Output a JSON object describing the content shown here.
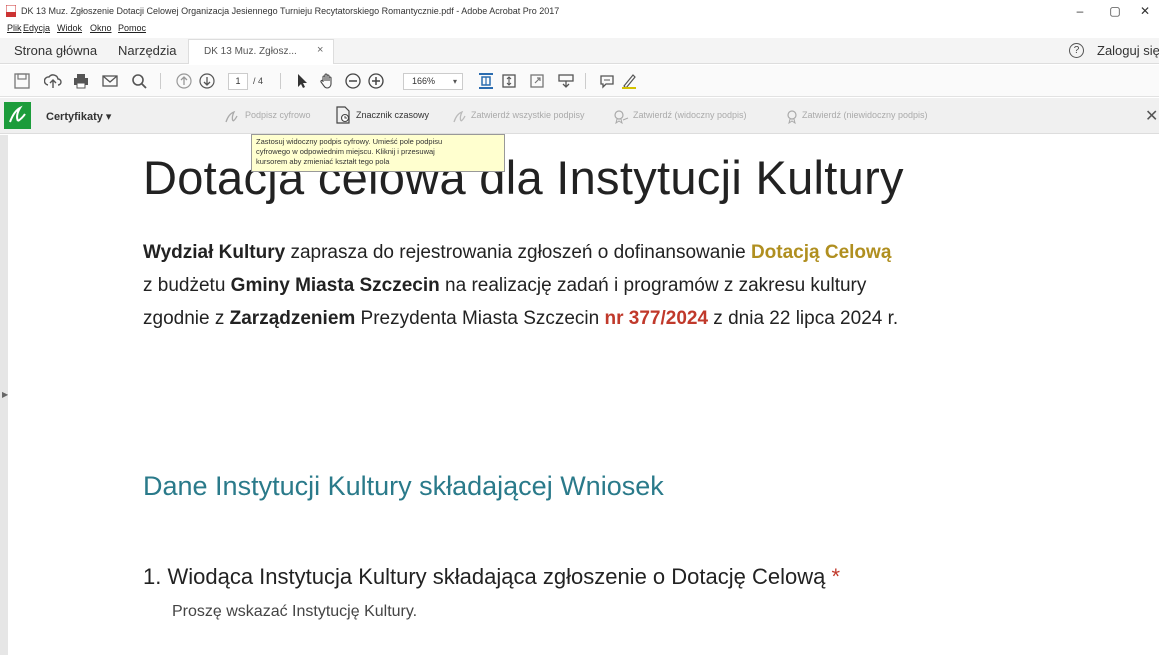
{
  "window": {
    "title": "DK 13 Muz. Zgłoszenie Dotacji Celowej Organizacja Jesiennego Turnieju Recytatorskiego Romantycznie.pdf - Adobe Acrobat Pro 2017",
    "minimize": "–",
    "maximize": "▢",
    "close": "✕"
  },
  "menu": [
    "Plik",
    "Edycja",
    "Widok",
    "Okno",
    "Pomoc"
  ],
  "tabs": {
    "home": "Strona główna",
    "tools": "Narzędzia",
    "document": "DK 13 Muz. Zgłosz...",
    "document_close": "×",
    "help": "?",
    "login": "Zaloguj się"
  },
  "toolbar": {
    "page_current": "1",
    "page_total": "/ 4",
    "zoom": "166%",
    "zoom_dropdown": "▾"
  },
  "certificates": {
    "title": "Certyfikaty ▾",
    "items": [
      {
        "label": "Podpisz cyfrowo",
        "enabled": false
      },
      {
        "label": "Znacznik czasowy",
        "enabled": true
      },
      {
        "label": "Zatwierdź wszystkie podpisy",
        "enabled": false
      },
      {
        "label": "Zatwierdź (widoczny podpis)",
        "enabled": false
      },
      {
        "label": "Zatwierdź (niewidoczny podpis)",
        "enabled": false
      }
    ],
    "close": "✕"
  },
  "tooltip": {
    "lines": [
      "Zastosuj widoczny podpis cyfrowy. Umieść pole podpisu",
      "cyfrowego w odpowiednim miejscu. Kliknij i przesuwaj",
      "kursorem aby zmieniać kształt tego pola"
    ]
  },
  "document": {
    "heading": "Dotacja celowa dla Instytucji Kultury",
    "para_line1": {
      "b1": "Wydział Kultury",
      "t1": " zaprasza do rejestrowania zgłoszeń o dofinansowanie ",
      "gold": "Dotacją Celową"
    },
    "para_line2": {
      "t1": "z budżetu ",
      "b1": "Gminy Miasta Szczecin",
      "t2": " na realizację zadań i programów z zakresu kultury"
    },
    "para_line3": {
      "t1": "zgodnie z ",
      "b1": "Zarządzeniem",
      "t2": " Prezydenta Miasta Szczecin ",
      "red": "nr 377/2024",
      "t3": " z dnia 22 lipca 2024 r."
    },
    "section_title": "Dane Instytucji Kultury składającej Wniosek",
    "question1": "1. Wiodąca Instytucja Kultury składająca zgłoszenie o Dotację Celową",
    "required_mark": " *",
    "question1_hint": "Proszę wskazać Instytucję Kultury."
  },
  "colors": {
    "accent_green": "#1c9c3b",
    "gold": "#b08f20",
    "red": "#c0392b",
    "section_teal": "#2a7a8a"
  }
}
